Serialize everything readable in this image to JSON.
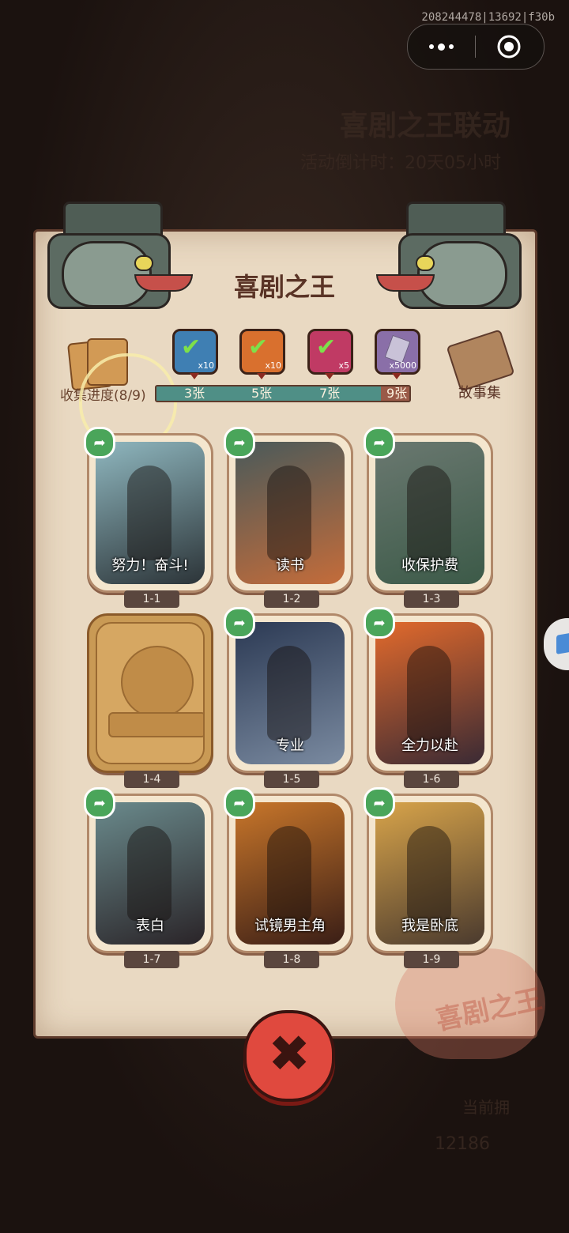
{
  "session_id": "208244478|13692|f30b",
  "background": {
    "event_title": "喜剧之王联动",
    "countdown": "活动倒计时：20天05小时",
    "current_label": "当前拥",
    "currency_count": "12186"
  },
  "panel": {
    "title": "喜剧之王",
    "collection_progress_label": "收集进度(8/9)",
    "collected": 8,
    "total": 9,
    "story_label": "故事集"
  },
  "milestones": [
    {
      "label": "3张",
      "reward_count": "x10",
      "claimed": true,
      "color": "#3f7fb3"
    },
    {
      "label": "5张",
      "reward_count": "x10",
      "claimed": true,
      "color": "#d9702e"
    },
    {
      "label": "7张",
      "reward_count": "x5",
      "claimed": true,
      "color": "#c03a64"
    },
    {
      "label": "9张",
      "reward_count": "x5000",
      "claimed": false,
      "color": "#8a6fa8"
    }
  ],
  "cards": [
    {
      "id": "1-1",
      "caption": "努力！奋斗!",
      "unlocked": true,
      "palette": [
        "#8fb7bf",
        "#2c3438"
      ]
    },
    {
      "id": "1-2",
      "caption": "读书",
      "unlocked": true,
      "palette": [
        "#4a5a5a",
        "#c46c3a"
      ]
    },
    {
      "id": "1-3",
      "caption": "收保护费",
      "unlocked": true,
      "palette": [
        "#6a7870",
        "#3c5a48"
      ]
    },
    {
      "id": "1-4",
      "caption": "",
      "unlocked": false,
      "palette": [
        "#d6a762",
        "#c08c48"
      ]
    },
    {
      "id": "1-5",
      "caption": "专业",
      "unlocked": true,
      "palette": [
        "#2c3a54",
        "#7a8aa0"
      ]
    },
    {
      "id": "1-6",
      "caption": "全力以赴",
      "unlocked": true,
      "palette": [
        "#e26a2c",
        "#3a2a34"
      ]
    },
    {
      "id": "1-7",
      "caption": "表白",
      "unlocked": true,
      "palette": [
        "#6a8a8c",
        "#2a2428"
      ]
    },
    {
      "id": "1-8",
      "caption": "试镜男主角",
      "unlocked": true,
      "palette": [
        "#c8762a",
        "#3a1e16"
      ]
    },
    {
      "id": "1-9",
      "caption": "我是卧底",
      "unlocked": true,
      "palette": [
        "#d8a44a",
        "#4a3a2e"
      ]
    }
  ]
}
